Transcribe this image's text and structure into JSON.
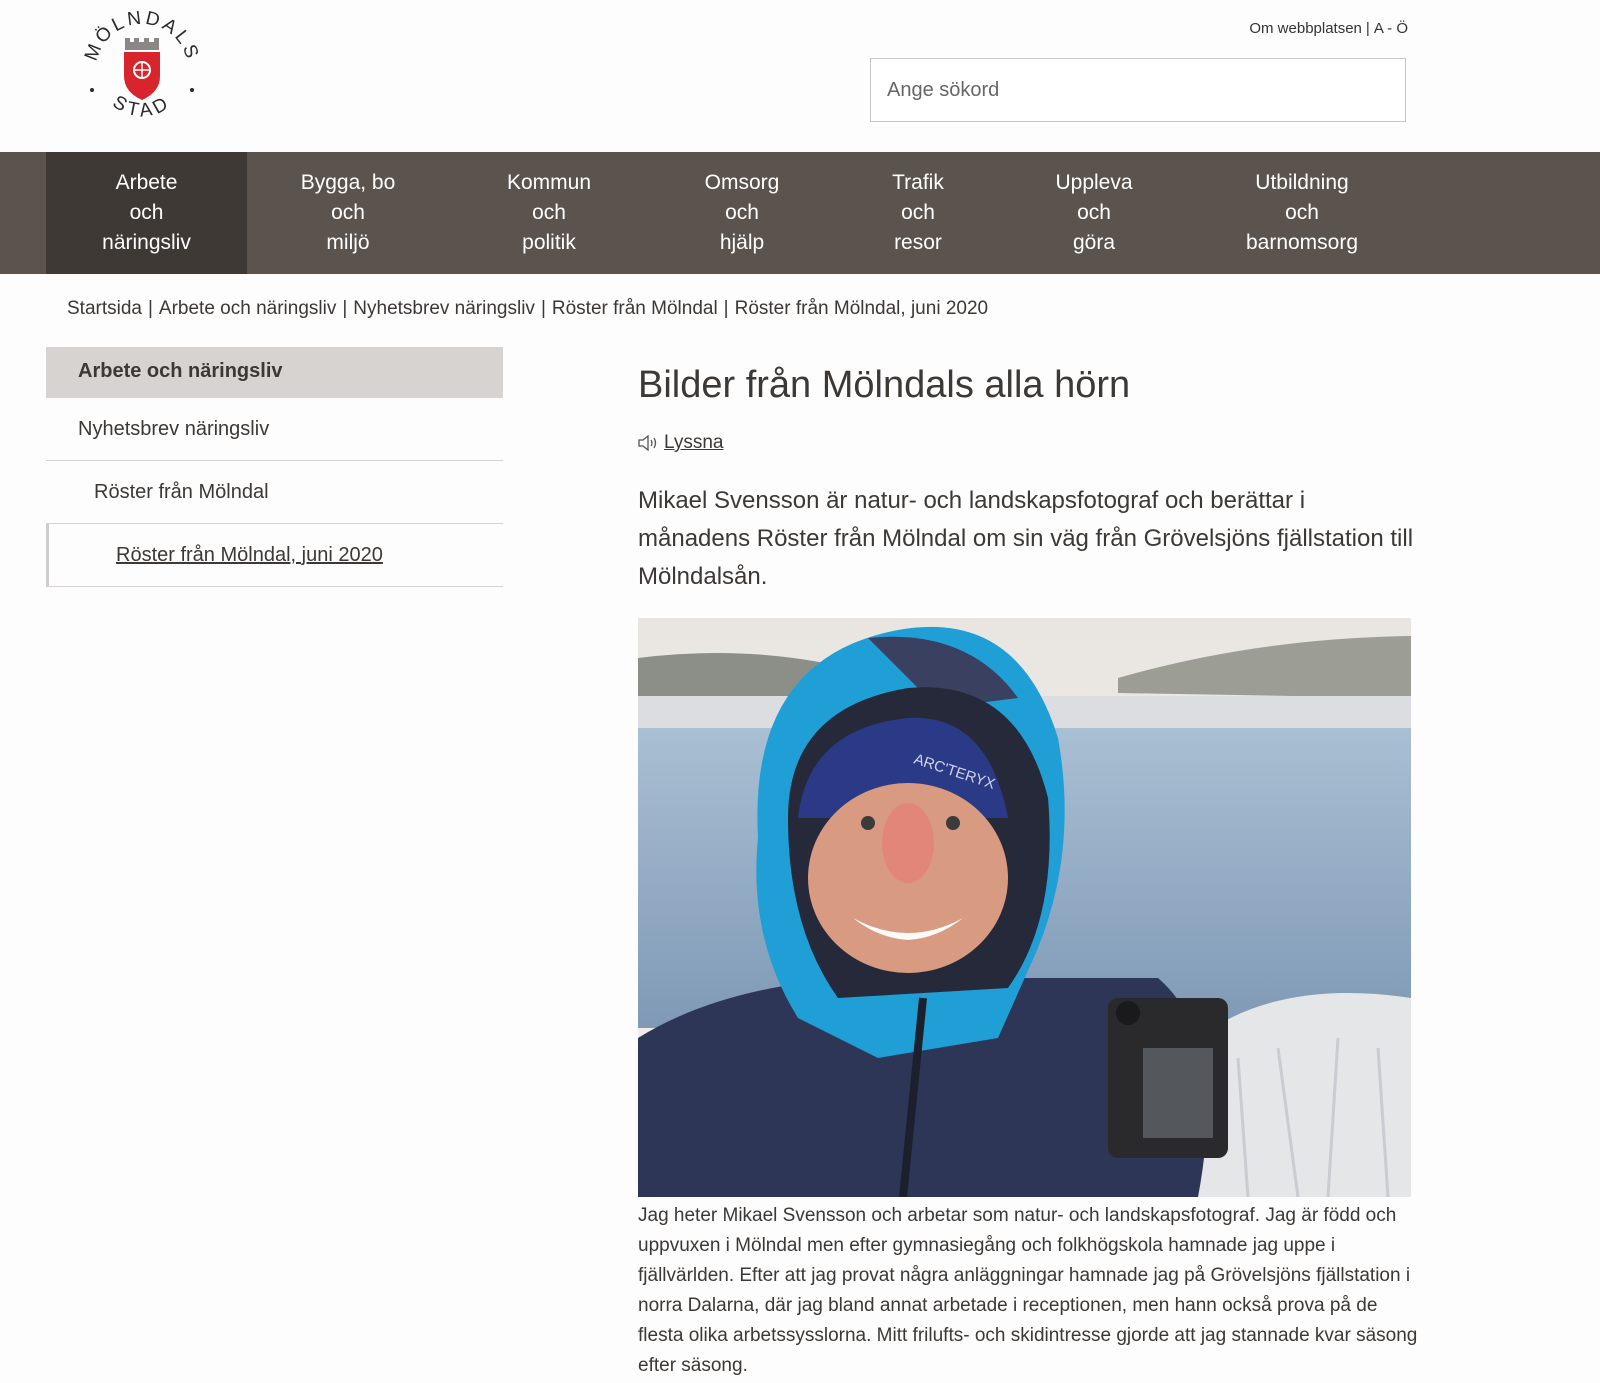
{
  "header": {
    "logo_text_top": "MÖLNDALS",
    "logo_text_bottom": "STAD",
    "top_links": [
      "Om webbplatsen",
      "A - Ö"
    ],
    "search_placeholder": "Ange sökord"
  },
  "nav": {
    "items": [
      {
        "lines": [
          "Arbete",
          "och",
          "näringsliv"
        ],
        "active": true
      },
      {
        "lines": [
          "Bygga, bo",
          "och",
          "miljö"
        ]
      },
      {
        "lines": [
          "Kommun",
          "och",
          "politik"
        ]
      },
      {
        "lines": [
          "Omsorg",
          "och",
          "hjälp"
        ]
      },
      {
        "lines": [
          "Trafik",
          "och",
          "resor"
        ]
      },
      {
        "lines": [
          "Uppleva",
          "och",
          "göra"
        ]
      },
      {
        "lines": [
          "Utbildning",
          "och",
          "barnomsorg"
        ]
      }
    ]
  },
  "breadcrumb": [
    "Startsida",
    "Arbete och näringsliv",
    "Nyhetsbrev näringsliv",
    "Röster från Mölndal",
    "Röster från Mölndal, juni 2020"
  ],
  "side_menu": {
    "heading": "Arbete och näringsliv",
    "items": [
      "Nyhetsbrev näringsliv",
      "Röster från Mölndal",
      "Röster från Mölndal, juni 2020"
    ]
  },
  "article": {
    "title": "Bilder från Mölndals alla hörn",
    "listen_label": "Lyssna",
    "lead": "Mikael Svensson är natur- och landskapsfotograf och berättar i månadens Röster från Mölndal om sin väg från Grövelsjöns fjällstation till Mölndalsån.",
    "photo_brand": "ARC'TERYX",
    "body": "Jag heter Mikael Svensson och arbetar som natur- och landskapsfotograf. Jag är född och uppvuxen i Mölndal men efter gymnasiegång och folkhögskola hamnade jag uppe i fjällvärlden. Efter att jag provat några anläggningar hamnade jag på Grövelsjöns fjällstation i norra Dalarna, där jag bland annat arbetade i receptionen, men hann också prova på de flesta olika arbetssysslorna. Mitt frilufts- och skidintresse gjorde att jag stannade kvar säsong efter säsong."
  },
  "colors": {
    "nav_bg": "#5a534e",
    "nav_active_bg": "#3f3935",
    "side_head_bg": "#d6d3d0",
    "text": "#3c3835",
    "logo_red": "#d8242c"
  }
}
